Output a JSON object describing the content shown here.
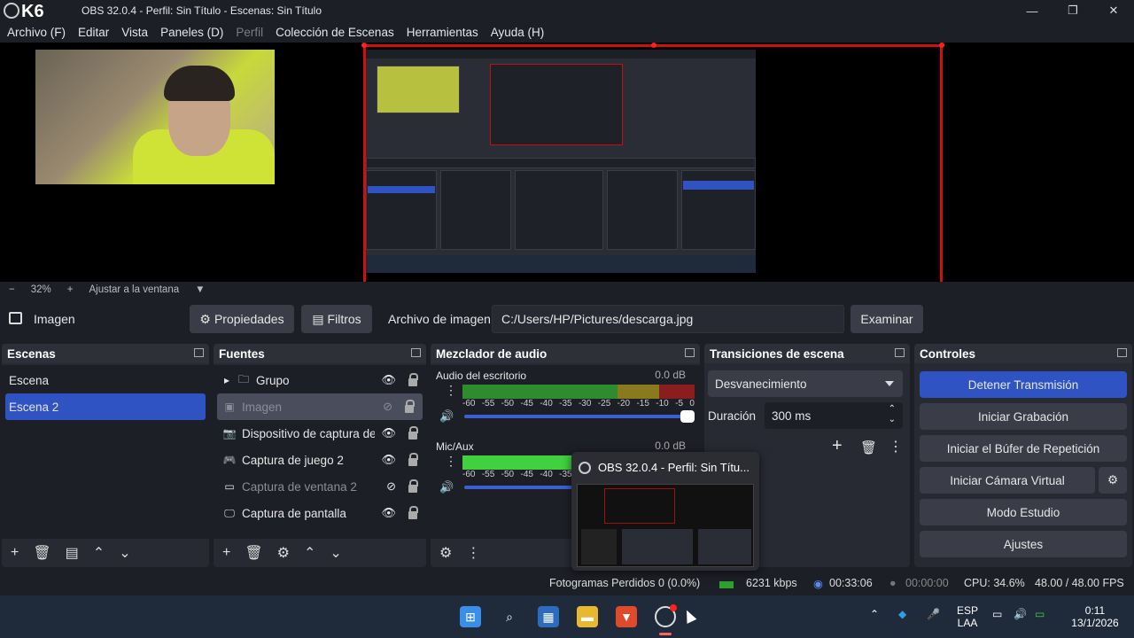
{
  "window": {
    "title": "OBS 32.0.4 - Perfil: Sin Título - Escenas: Sin Título",
    "overlay_badge": "K6"
  },
  "menu": [
    "Archivo (F)",
    "Editar",
    "Vista",
    "Paneles (D)",
    "Perfil",
    "Colección de Escenas",
    "Herramientas",
    "Ayuda (H)"
  ],
  "zoom": {
    "level": "32%",
    "fit_label": "Ajustar a la ventana"
  },
  "properties_bar": {
    "source_name": "Imagen",
    "properties_label": "Propiedades",
    "filters_label": "Filtros",
    "file_label": "Archivo de imagen",
    "file_path": "C:/Users/HP/Pictures/descarga.jpg",
    "browse_label": "Examinar"
  },
  "scenes": {
    "title": "Escenas",
    "items": [
      "Escena",
      "Escena 2"
    ],
    "selected_index": 1
  },
  "sources": {
    "title": "Fuentes",
    "items": [
      {
        "label": "Grupo",
        "icon": "folder-icon",
        "visible": true
      },
      {
        "label": "Imagen",
        "icon": "image-icon",
        "visible": false
      },
      {
        "label": "Dispositivo de captura de vídeo",
        "icon": "camera-icon",
        "visible": true
      },
      {
        "label": "Captura de juego 2",
        "icon": "gamepad-icon",
        "visible": true
      },
      {
        "label": "Captura de ventana 2",
        "icon": "window-icon",
        "visible": false
      },
      {
        "label": "Captura de pantalla",
        "icon": "monitor-icon",
        "visible": true
      }
    ]
  },
  "mixer": {
    "title": "Mezclador de audio",
    "channels": [
      {
        "name": "Audio del escritorio",
        "db": "0.0 dB"
      },
      {
        "name": "Mic/Aux",
        "db": "0.0 dB"
      }
    ],
    "ticks": [
      "-60",
      "-55",
      "-50",
      "-45",
      "-40",
      "-35",
      "-30",
      "-25",
      "-20",
      "-15",
      "-10",
      "-5",
      "0"
    ]
  },
  "transitions": {
    "title": "Transiciones de escena",
    "selected": "Desvanecimiento",
    "duration_label": "Duración",
    "duration_value": "300 ms"
  },
  "controls": {
    "title": "Controles",
    "stop_stream": "Detener Transmisión",
    "start_record": "Iniciar Grabación",
    "replay_buffer": "Iniciar el Búfer de Repetición",
    "virtual_cam": "Iniciar Cámara Virtual",
    "studio_mode": "Modo Estudio",
    "settings": "Ajustes"
  },
  "status": {
    "dropped_frames": "Fotogramas Perdidos 0 (0.0%)",
    "bitrate": "6231 kbps",
    "stream_time": "00:33:06",
    "record_time": "00:00:00",
    "cpu": "CPU: 34.6%",
    "fps": "48.00 / 48.00 FPS"
  },
  "taskbar_popup": {
    "title": "OBS 32.0.4 - Perfil: Sin Títu..."
  },
  "tray": {
    "lang_top": "ESP",
    "lang_bottom": "LAA",
    "time": "0:11",
    "date": "13/1/2026"
  },
  "colors": {
    "accent": "#2f53c2",
    "recording_border": "#d01010",
    "meter_green": "#2e8b2e",
    "meter_yellow": "#8a7a1e",
    "meter_red": "#8a1e1e"
  }
}
